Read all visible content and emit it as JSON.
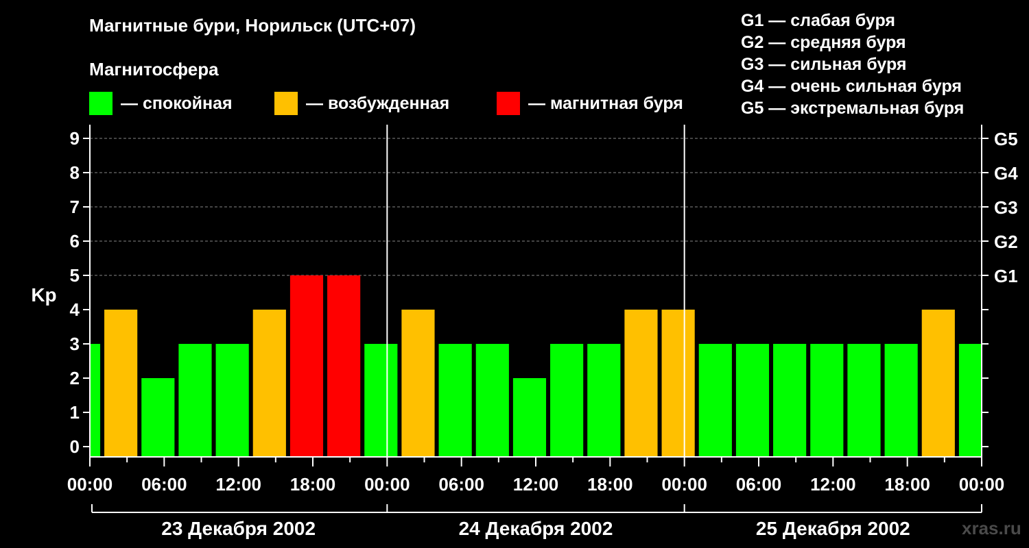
{
  "header": {
    "title": "Магнитные бури, Норильск (UTC+07)",
    "subtitle": "Магнитосфера",
    "legend": [
      {
        "label": "— спокойная",
        "color": "#00ff00"
      },
      {
        "label": "— возбужденная",
        "color": "#ffc000"
      },
      {
        "label": "— магнитная буря",
        "color": "#ff0000"
      }
    ]
  },
  "storm_scale": [
    "G1 — слабая буря",
    "G2 — средняя буря",
    "G3 — сильная буря",
    "G4 — очень сильная буря",
    "G5 — экстремальная буря"
  ],
  "credit": "xras.ru",
  "chart_data": {
    "type": "bar",
    "ylabel": "Kp",
    "ylim": [
      0,
      9
    ],
    "yticks": [
      0,
      1,
      2,
      3,
      4,
      5,
      6,
      7,
      8,
      9
    ],
    "right_axis_labels": [
      {
        "value": 5,
        "label": "G1"
      },
      {
        "value": 6,
        "label": "G2"
      },
      {
        "value": 7,
        "label": "G3"
      },
      {
        "value": 8,
        "label": "G4"
      },
      {
        "value": 9,
        "label": "G5"
      }
    ],
    "xticks": [
      "00:00",
      "06:00",
      "12:00",
      "18:00",
      "00:00",
      "06:00",
      "12:00",
      "18:00",
      "00:00",
      "06:00",
      "12:00",
      "18:00",
      "00:00"
    ],
    "days": [
      "23 Декабря 2002",
      "24 Декабря 2002",
      "25 Декабря 2002"
    ],
    "grid": true,
    "bar_start_hours": [
      -2,
      1,
      4,
      7,
      10,
      13,
      16,
      19,
      22,
      25,
      28,
      31,
      34,
      37,
      40,
      43,
      46,
      49,
      52,
      55,
      58,
      61,
      64,
      67,
      70
    ],
    "values": [
      3,
      4,
      2,
      3,
      3,
      4,
      5,
      5,
      3,
      4,
      3,
      3,
      2,
      3,
      3,
      4,
      4,
      3,
      3,
      3,
      3,
      3,
      3,
      4,
      3
    ],
    "colors": {
      "quiet": "#00ff00",
      "active": "#ffc000",
      "storm": "#ff0000"
    }
  }
}
